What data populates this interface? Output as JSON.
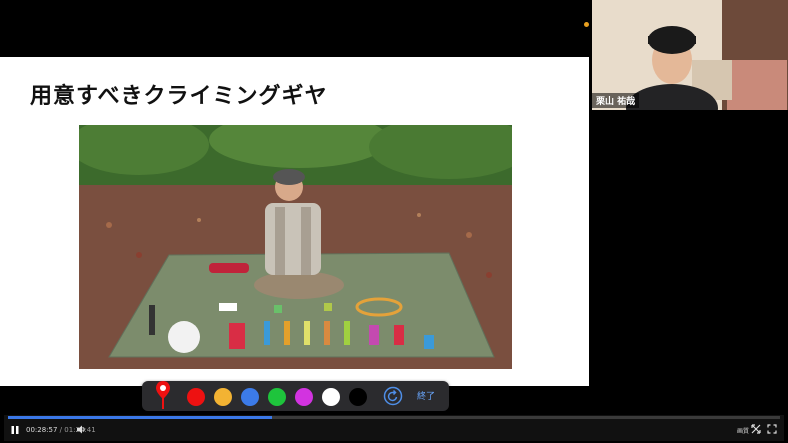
{
  "slide": {
    "title": "用意すべきクライミングギヤ"
  },
  "camera": {
    "participant_name": "栗山 祐哉"
  },
  "pen_toolbar": {
    "pen_icon": "pen-marker-icon",
    "colors": [
      "#ee1111",
      "#f3b333",
      "#3c7be8",
      "#1ec43c",
      "#d233e0",
      "#ffffff",
      "#000000"
    ],
    "undo_icon": "undo-icon",
    "end_label": "終了"
  },
  "player": {
    "current_time": "00:28:57",
    "separator": " / ",
    "duration": "01:24:41",
    "progress_fraction": 0.342,
    "quality_label": "画質",
    "play_icon": "pause-icon",
    "volume_icon": "volume-icon",
    "pin_icon": "expand-arrows-icon",
    "fullscreen_icon": "fullscreen-icon"
  }
}
